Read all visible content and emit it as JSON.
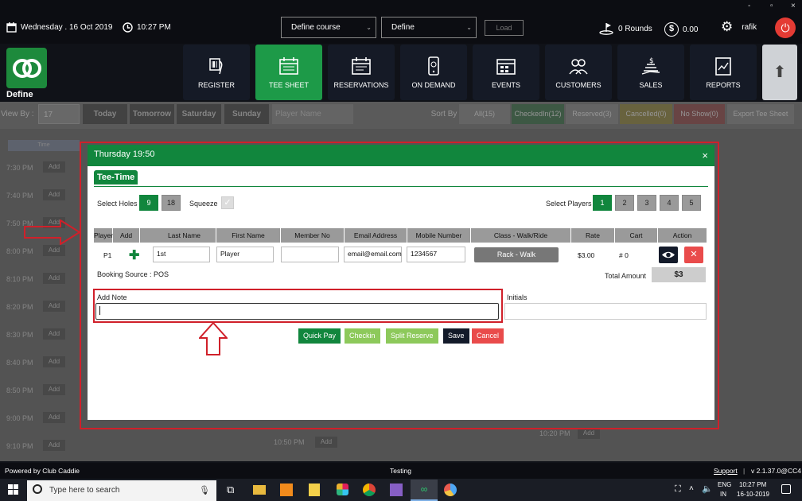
{
  "window": {
    "minimize": "-",
    "restore": "▫",
    "close": "×"
  },
  "topbar": {
    "date": "Wednesday . 16 Oct 2019",
    "time": "10:27 PM",
    "course_select": "Define course",
    "define_select": "Define",
    "load_button": "Load",
    "rounds": "0 Rounds",
    "balance": "0.00",
    "user": "rafik"
  },
  "logo": {
    "name": "Define"
  },
  "nav": [
    {
      "label": "REGISTER",
      "icon": "barcode-scanner-icon",
      "active": false
    },
    {
      "label": "TEE SHEET",
      "icon": "calendar-icon",
      "active": true
    },
    {
      "label": "RESERVATIONS",
      "icon": "calendar-list-icon",
      "active": false
    },
    {
      "label": "ON DEMAND",
      "icon": "mobile-icon",
      "active": false
    },
    {
      "label": "EVENTS",
      "icon": "events-calendar-icon",
      "active": false
    },
    {
      "label": "CUSTOMERS",
      "icon": "customers-icon",
      "active": false
    },
    {
      "label": "SALES",
      "icon": "sales-icon",
      "active": false
    },
    {
      "label": "REPORTS",
      "icon": "reports-icon",
      "active": false
    }
  ],
  "filterbar": {
    "view_by": "View By :",
    "date_value": "17",
    "days": [
      "Today",
      "Tomorrow",
      "Saturday",
      "Sunday"
    ],
    "player_placeholder": "Player Name",
    "sort_by": "Sort By",
    "sort_options": [
      "All(15)",
      "CheckedIn(12)",
      "Reserved(3)",
      "Cancelled(0)",
      "No Show(0)"
    ],
    "export": "Export Tee Sheet"
  },
  "background": {
    "column_header": "Time",
    "slots": [
      "7:30 PM",
      "7:40 PM",
      "7:50 PM",
      "8:00 PM",
      "8:10 PM",
      "8:20 PM",
      "8:30 PM",
      "8:40 PM",
      "8:50 PM",
      "9:00 PM",
      "9:10 PM"
    ],
    "add_label": "Add",
    "mid_slot": "10:50 PM",
    "right_slot": "10:20 PM"
  },
  "modal": {
    "title": "Thursday 19:50",
    "close": "×",
    "tab": "Tee-Time",
    "select_holes_label": "Select Holes",
    "holes": [
      "9",
      "18"
    ],
    "squeeze_label": "Squeeze",
    "select_players_label": "Select Players",
    "players": [
      "1",
      "2",
      "3",
      "4",
      "5"
    ],
    "columns": [
      "Player",
      "Add",
      "Last Name",
      "First Name",
      "Member No",
      "Email Address",
      "Mobile Number",
      "Class - Walk/Ride",
      "Rate",
      "Cart",
      "Action"
    ],
    "row": {
      "player": "P1",
      "last_name": "1st",
      "first_name": "Player",
      "member_no": "",
      "email": "email@email.com",
      "mobile": "1234567",
      "class": "Rack - Walk",
      "rate": "$3.00",
      "cart": "# 0"
    },
    "booking_source": "Booking Source : POS",
    "total_amount_label": "Total Amount",
    "total_amount": "$3",
    "add_note_label": "Add Note",
    "add_note_value": "",
    "initials_label": "Initials",
    "initials_value": "",
    "buttons": {
      "quick_pay": "Quick Pay",
      "checkin": "Checkin",
      "split_reserve": "Split Reserve",
      "save": "Save",
      "cancel": "Cancel"
    }
  },
  "statusbar": {
    "powered_by": "Powered by Club Caddie",
    "env": "Testing",
    "support": "Support",
    "version": "v 2.1.37.0@CC4"
  },
  "taskbar": {
    "search_placeholder": "Type here to search",
    "lang": "ENG",
    "region": "IN",
    "time": "10:27 PM",
    "date": "16-10-2019"
  },
  "colors": {
    "brand_green": "#11863d",
    "annotation_red": "#d0202a",
    "light_green": "#8dc95b",
    "cancel_red": "#e94b4b"
  }
}
